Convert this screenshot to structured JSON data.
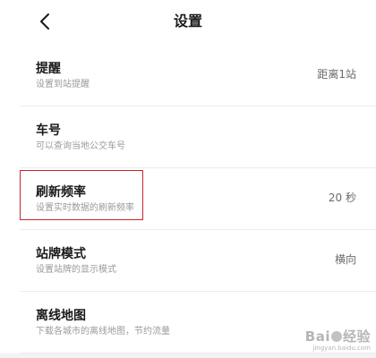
{
  "header": {
    "title": "设置"
  },
  "settings": [
    {
      "title": "提醒",
      "desc": "设置到站提醒",
      "value": "距离1站"
    },
    {
      "title": "车号",
      "desc": "可以查询当地公交车号",
      "value": ""
    },
    {
      "title": "刷新频率",
      "desc": "设置实时数据的刷新频率",
      "value": "20 秒"
    },
    {
      "title": "站牌模式",
      "desc": "设置站牌的显示模式",
      "value": "横向"
    },
    {
      "title": "离线地图",
      "desc": "下载各城市的离线地图，节约流量",
      "value": ""
    }
  ],
  "watermark": {
    "left": "Bai",
    "right": "经验",
    "sub": "jingyan.baidu.com"
  },
  "colors": {
    "highlight": "#c8262b",
    "background": "#f3f3f3"
  }
}
